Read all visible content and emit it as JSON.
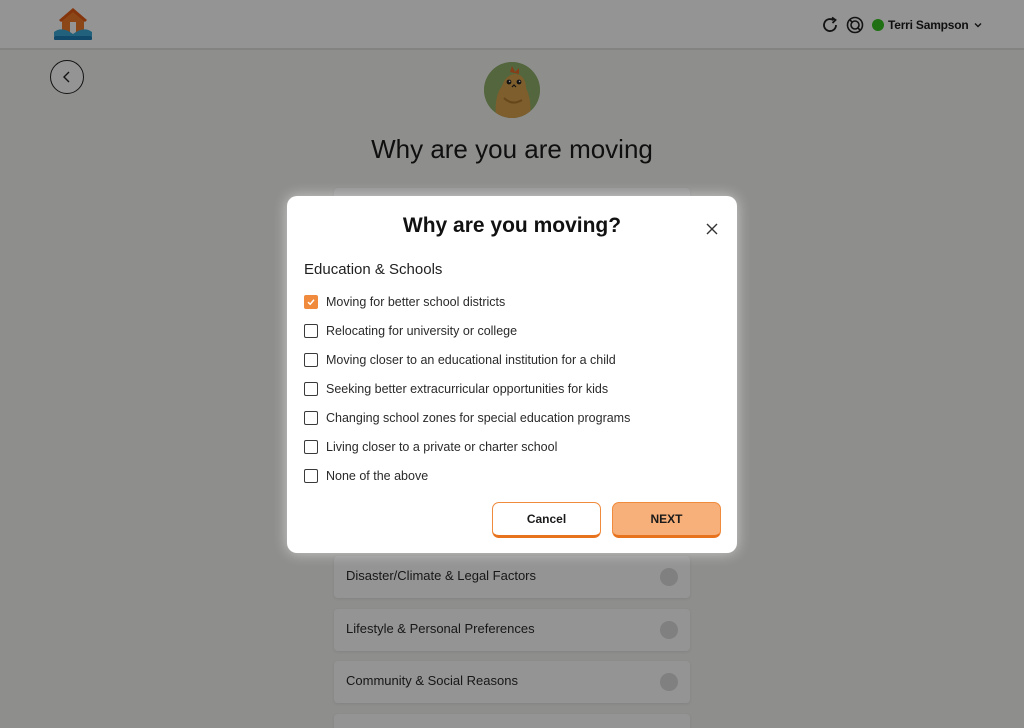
{
  "header": {
    "logo_icon": "company-logo-house",
    "refresh_icon": "refresh-icon",
    "help_icon": "help-icon",
    "user": {
      "name": "Terri Sampson",
      "status_color": "#35c21f"
    },
    "chevron_icon": "chevron-down-icon"
  },
  "page": {
    "back_icon": "chevron-left-icon",
    "title": "Why are you are moving",
    "categories": [
      {
        "label": "Disaster/Climate & Legal Factors"
      },
      {
        "label": "Lifestyle & Personal Preferences"
      },
      {
        "label": "Community & Social Reasons"
      }
    ]
  },
  "modal": {
    "title": "Why are you moving?",
    "section": "Education & Schools",
    "options": [
      {
        "label": "Moving for better school districts",
        "checked": true
      },
      {
        "label": "Relocating for university or college",
        "checked": false
      },
      {
        "label": "Moving closer to an educational institution for a child",
        "checked": false
      },
      {
        "label": "Seeking better extracurricular opportunities for kids",
        "checked": false
      },
      {
        "label": "Changing school zones for special education programs",
        "checked": false
      },
      {
        "label": "Living closer to a private or charter school",
        "checked": false
      },
      {
        "label": "None of the above",
        "checked": false
      }
    ],
    "cancel_label": "Cancel",
    "next_label": "NEXT"
  },
  "colors": {
    "accent": "#f08a3c",
    "next_bg": "#f8b07a"
  }
}
